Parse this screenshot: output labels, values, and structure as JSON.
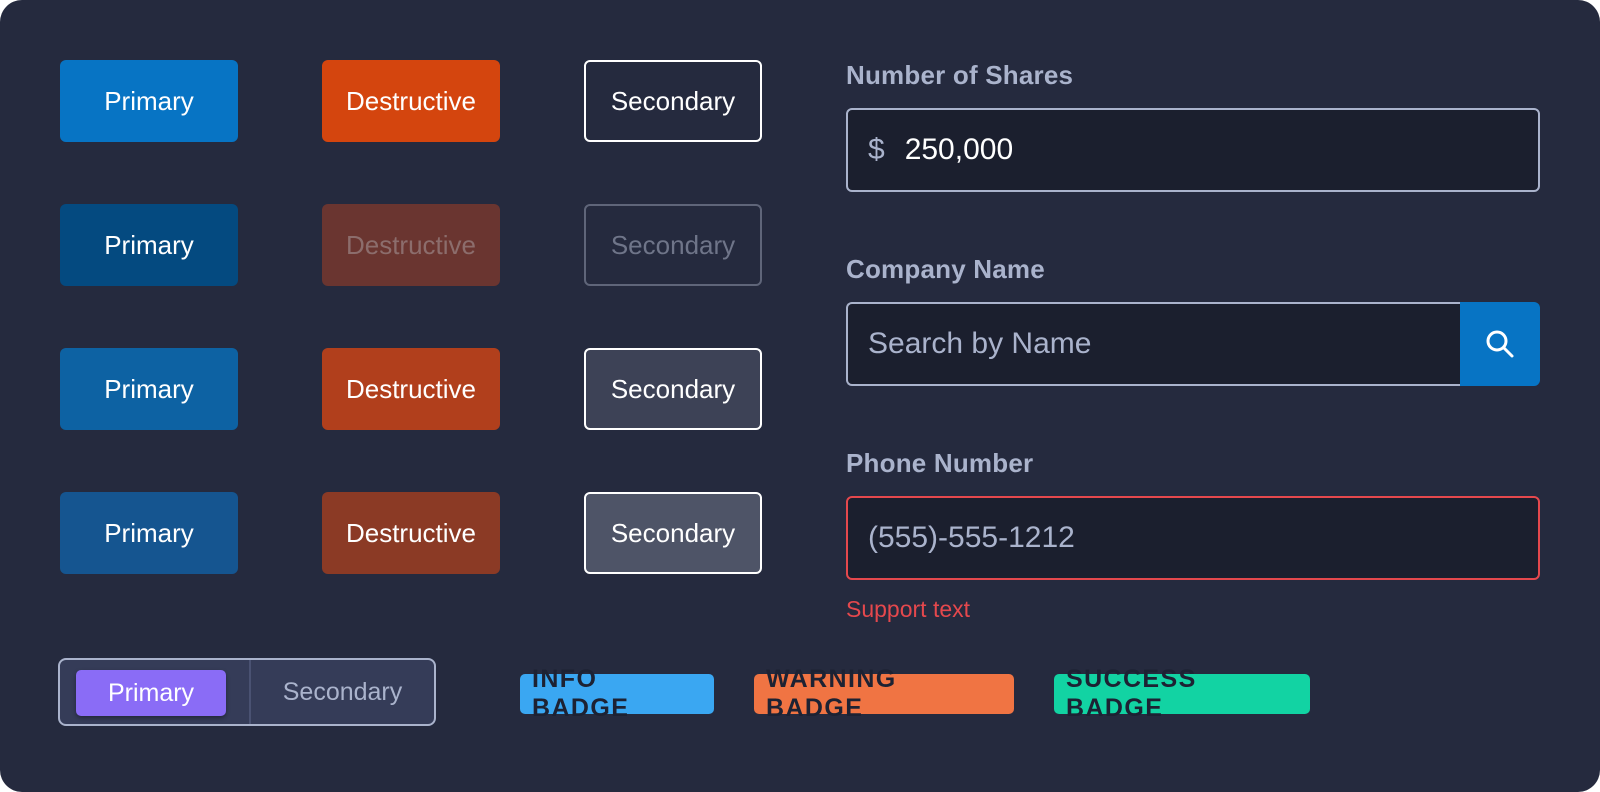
{
  "buttons": {
    "primary_label": "Primary",
    "destructive_label": "Destructive",
    "secondary_label": "Secondary"
  },
  "shares": {
    "label": "Number of Shares",
    "currency_symbol": "$",
    "value": "250,000"
  },
  "company": {
    "label": "Company Name",
    "placeholder": "Search by Name",
    "search_icon": "search-icon"
  },
  "phone": {
    "label": "Phone Number",
    "placeholder": "(555)-555-1212",
    "support_text": "Support text"
  },
  "segmented": {
    "primary_label": "Primary",
    "secondary_label": "Secondary",
    "selected": "Primary"
  },
  "badges": {
    "info": "INFO BADGE",
    "warning": "WARNING BADGE",
    "success": "SUCCESS BADGE"
  },
  "colors": {
    "background": "#252a3e",
    "primary": "#0774c4",
    "destructive": "#d4450e",
    "error": "#e5484d",
    "segment_selected": "#8a6cf6",
    "info_badge": "#3aa7f2",
    "warning_badge": "#f07443",
    "success_badge": "#12d3a3"
  }
}
